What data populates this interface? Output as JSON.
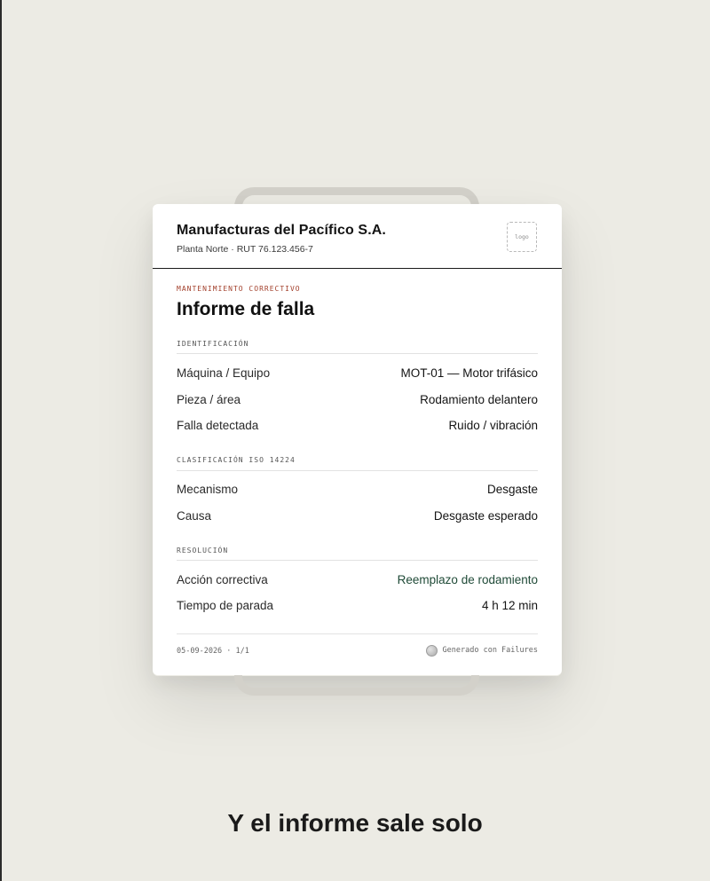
{
  "report": {
    "company_name": "Manufacturas del Pacífico S.A.",
    "company_sub": "Planta Norte · RUT 76.123.456-7",
    "logo_placeholder": "logo",
    "kicker": "MANTENIMIENTO CORRECTIVO",
    "title": "Informe de falla",
    "sections": {
      "identificacion": {
        "heading": "IDENTIFICACIÓN",
        "rows": [
          {
            "label": "Máquina / Equipo",
            "value": "MOT-01 — Motor trifásico"
          },
          {
            "label": "Pieza / área",
            "value": "Rodamiento delantero"
          },
          {
            "label": "Falla detectada",
            "value": "Ruido / vibración"
          }
        ]
      },
      "clasificacion": {
        "heading": "CLASIFICACIÓN ISO 14224",
        "rows": [
          {
            "label": "Mecanismo",
            "value": "Desgaste"
          },
          {
            "label": "Causa",
            "value": "Desgaste esperado"
          }
        ]
      },
      "resolucion": {
        "heading": "RESOLUCIÓN",
        "rows": [
          {
            "label": "Acción correctiva",
            "value": "Reemplazo de rodamiento"
          },
          {
            "label": "Tiempo de parada",
            "value": "4 h 12 min"
          }
        ]
      }
    },
    "footer": {
      "date_page": "05-09-2026 · 1/1",
      "generated_by": "Generado con Failures",
      "brand_icon": "brand-dot-icon"
    }
  },
  "caption": "Y el informe sale solo",
  "colors": {
    "background": "#ecebe4",
    "kicker": "#a3412d",
    "accent_value": "#1f4a37",
    "card": "#ffffff"
  }
}
